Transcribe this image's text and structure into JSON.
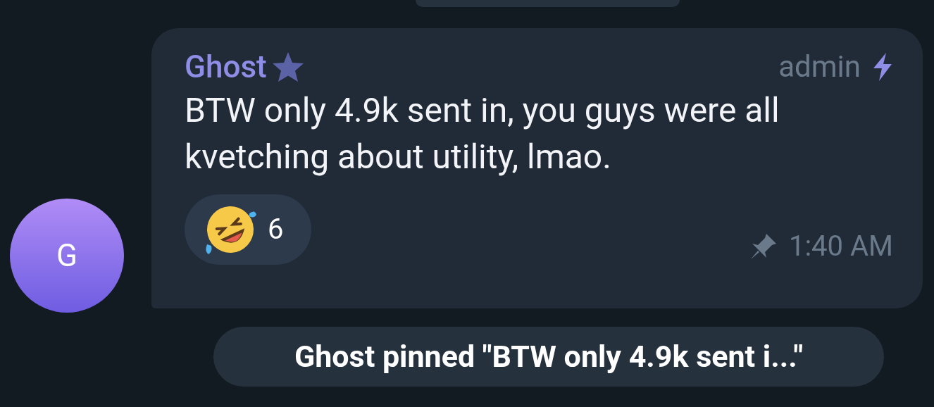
{
  "avatar": {
    "letter": "G"
  },
  "message": {
    "sender": "Ghost",
    "badge": "admin",
    "text": "BTW only 4.9k sent in, you guys were all kvetching about utility, lmao.",
    "reactions": [
      {
        "count": "6"
      }
    ],
    "pinned": true,
    "time": "1:40 AM"
  },
  "service_message": {
    "text": "Ghost pinned \"BTW only 4.9k sent i...\""
  }
}
